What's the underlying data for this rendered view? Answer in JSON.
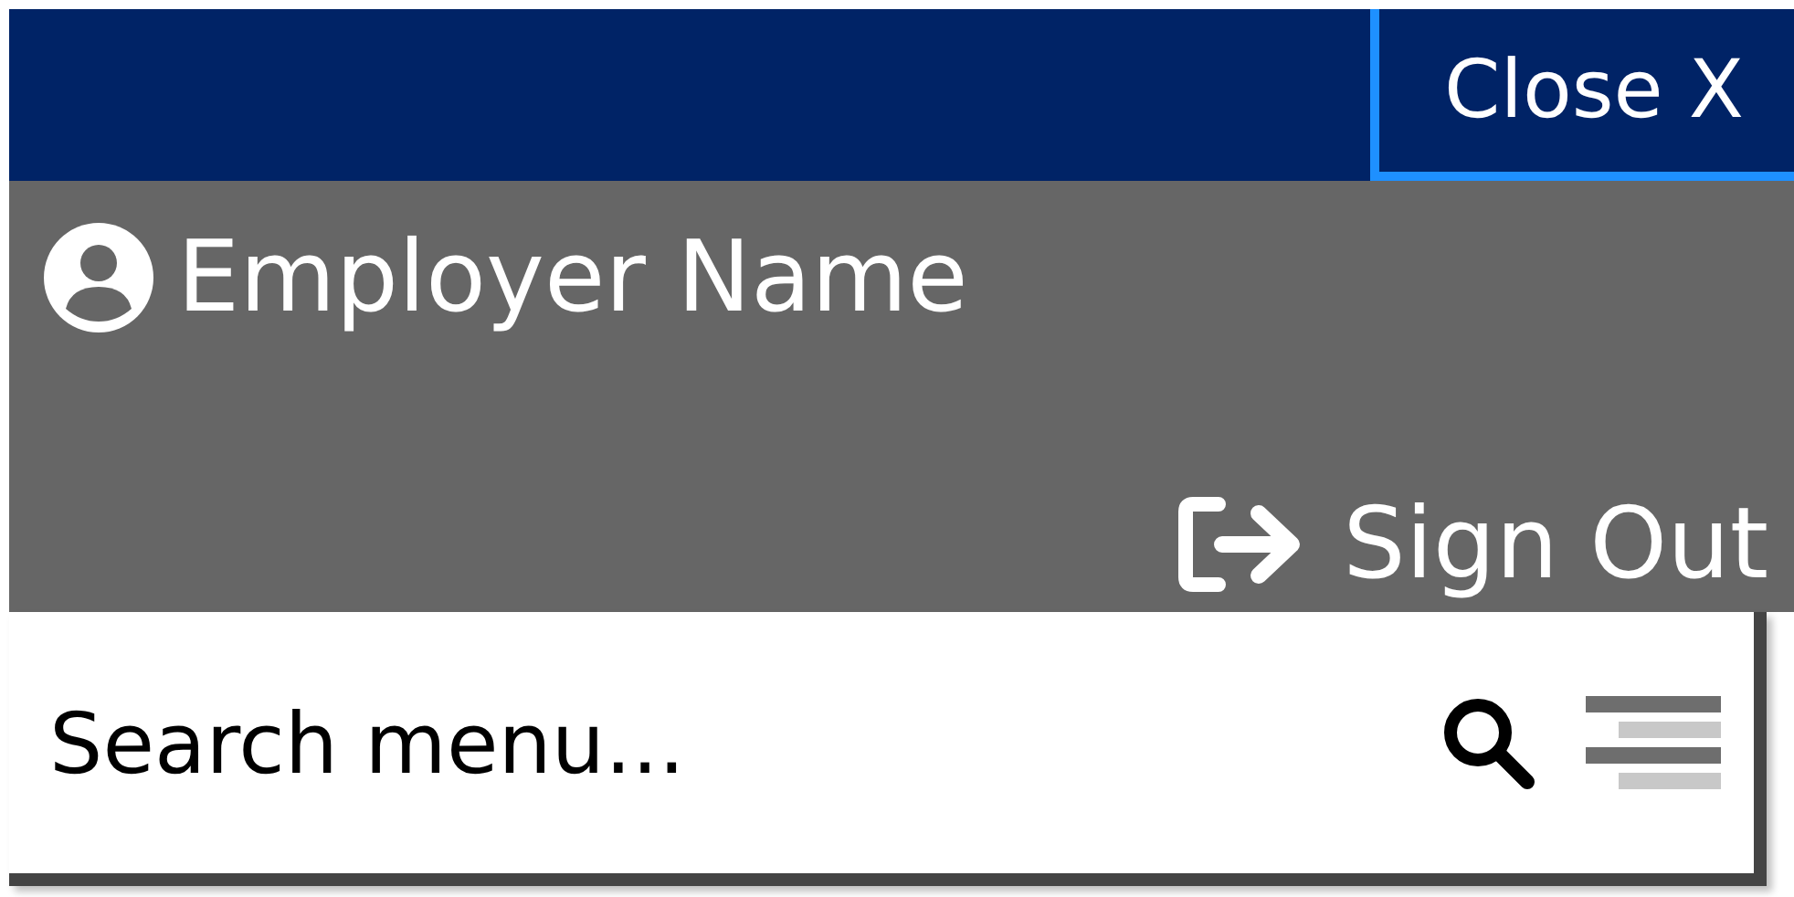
{
  "header": {
    "close_button": "Close X"
  },
  "user_panel": {
    "name": "Employer Name",
    "sign_out": "Sign Out"
  },
  "search": {
    "placeholder": "Search menu..."
  }
}
